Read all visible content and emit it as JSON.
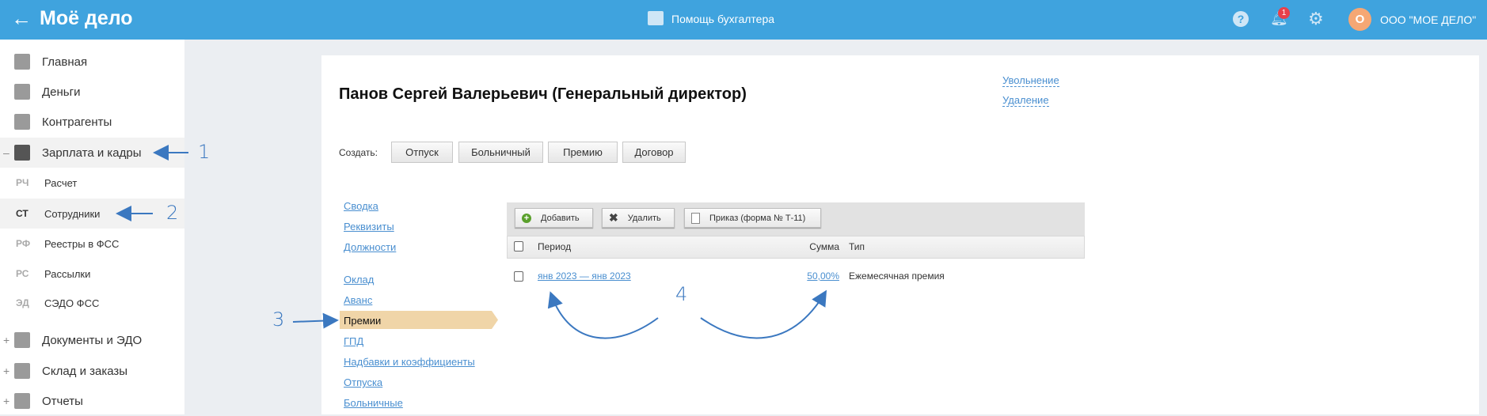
{
  "header": {
    "logo": "Моё дело",
    "help_center": "Помощь бухгалтера",
    "notifications_count": "1",
    "avatar_letter": "О",
    "company": "ООО \"МОЕ ДЕЛО\""
  },
  "sidebar": {
    "items": [
      {
        "label": "Главная"
      },
      {
        "label": "Деньги"
      },
      {
        "label": "Контрагенты"
      },
      {
        "label": "Зарплата и кадры",
        "toggle": "–"
      },
      {
        "label": "Документы и ЭДО",
        "toggle": "+"
      },
      {
        "label": "Склад и заказы",
        "toggle": "+"
      },
      {
        "label": "Отчеты",
        "toggle": "+"
      }
    ],
    "sub": [
      {
        "abbr": "РЧ",
        "label": "Расчет"
      },
      {
        "abbr": "СТ",
        "label": "Сотрудники"
      },
      {
        "abbr": "РФ",
        "label": "Реестры в ФСС"
      },
      {
        "abbr": "РС",
        "label": "Рассылки"
      },
      {
        "abbr": "ЭД",
        "label": "СЭДО ФСС"
      }
    ]
  },
  "employee": {
    "title": "Панов Сергей Валерьевич (Генеральный директор)",
    "dismiss": "Увольнение",
    "delete": "Удаление"
  },
  "create": {
    "label": "Создать:",
    "buttons": [
      "Отпуск",
      "Больничный",
      "Премию",
      "Договор"
    ]
  },
  "nav": [
    "Сводка",
    "Реквизиты",
    "Должности",
    "Оклад",
    "Аванс",
    "Премии",
    "ГПД",
    "Надбавки и коэффициенты",
    "Отпуска",
    "Больничные"
  ],
  "toolbar": {
    "add": "Добавить",
    "remove": "Удалить",
    "order": "Приказ (форма № Т-11)"
  },
  "table": {
    "headers": [
      "Период",
      "Сумма",
      "Тип"
    ],
    "rows": [
      {
        "period": "янв 2023 — янв 2023",
        "sum": "50,00%",
        "type": "Ежемесячная премия"
      }
    ]
  },
  "annotations": [
    "1",
    "2",
    "3",
    "4"
  ]
}
